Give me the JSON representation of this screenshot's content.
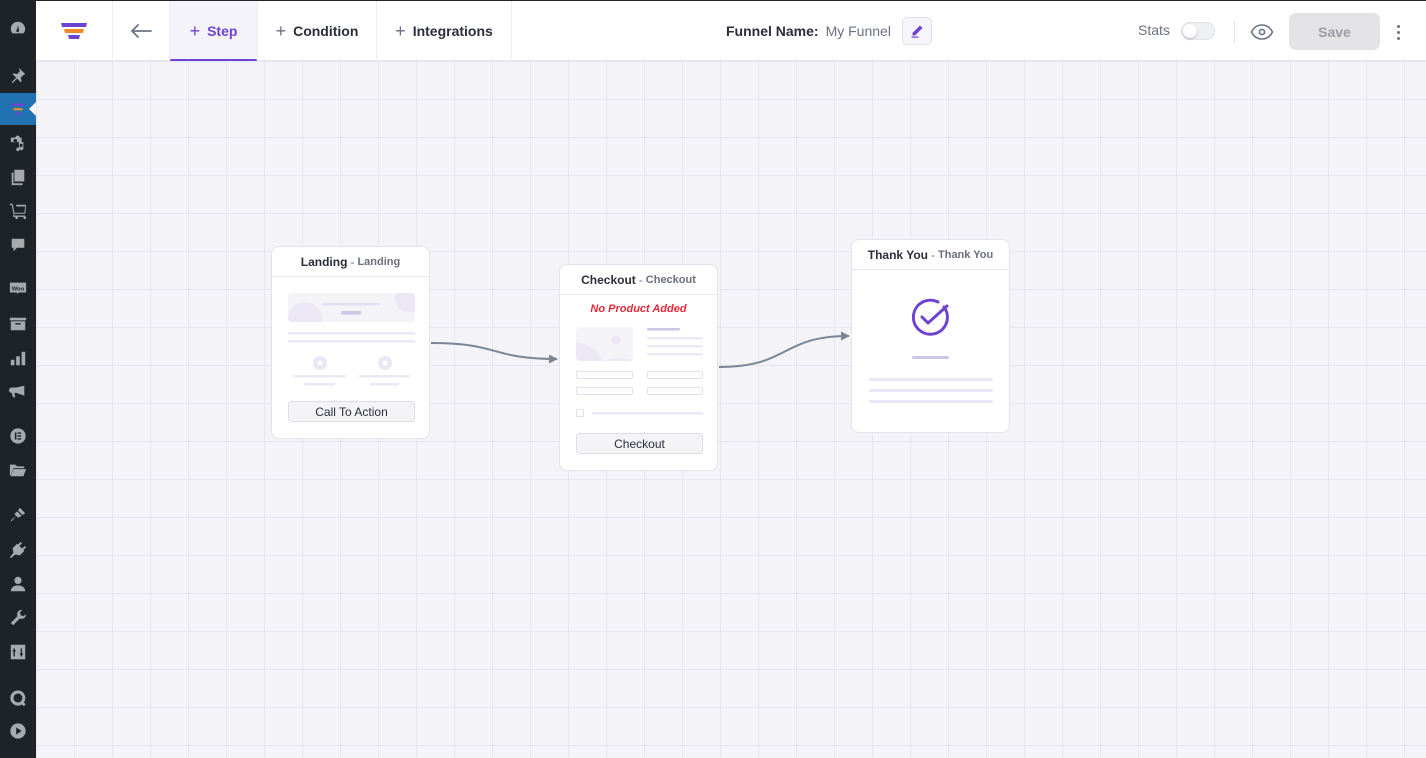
{
  "sidebar": {
    "items": [
      {
        "icon": "dashboard-icon"
      },
      {
        "icon": "pin-icon"
      },
      {
        "icon": "funnel-icon",
        "active": true
      },
      {
        "icon": "media-icon"
      },
      {
        "icon": "pages-icon"
      },
      {
        "icon": "cart-icon"
      },
      {
        "icon": "comments-icon"
      },
      {
        "icon": "woo-icon",
        "label": "Woo"
      },
      {
        "icon": "archive-icon"
      },
      {
        "icon": "analytics-icon"
      },
      {
        "icon": "megaphone-icon"
      },
      {
        "icon": "elementor-icon"
      },
      {
        "icon": "folder-icon"
      },
      {
        "icon": "brush-icon"
      },
      {
        "icon": "plugin-icon"
      },
      {
        "icon": "user-icon"
      },
      {
        "icon": "wrench-icon"
      },
      {
        "icon": "settings-sliders-icon"
      },
      {
        "icon": "q-icon"
      },
      {
        "icon": "play-icon"
      }
    ]
  },
  "toolbar": {
    "tabs": [
      {
        "label": "Step",
        "active": true
      },
      {
        "label": "Condition"
      },
      {
        "label": "Integrations"
      }
    ],
    "funnel_name_label": "Funnel Name:",
    "funnel_name_value": "My Funnel",
    "stats_label": "Stats",
    "stats_enabled": false,
    "save_label": "Save",
    "accent_color": "#6e42d3"
  },
  "canvas": {
    "nodes": [
      {
        "title": "Landing",
        "separator": "-",
        "type": "Landing",
        "button": "Call To Action"
      },
      {
        "title": "Checkout",
        "separator": "-",
        "type": "Checkout",
        "warning": "No Product Added",
        "button": "Checkout"
      },
      {
        "title": "Thank You",
        "separator": "-",
        "type": "Thank You"
      }
    ],
    "edges": [
      {
        "from": "Landing",
        "to": "Checkout"
      },
      {
        "from": "Checkout",
        "to": "Thank You"
      }
    ],
    "edge_color": "#7a8694",
    "warning_color": "#e02a3c"
  }
}
